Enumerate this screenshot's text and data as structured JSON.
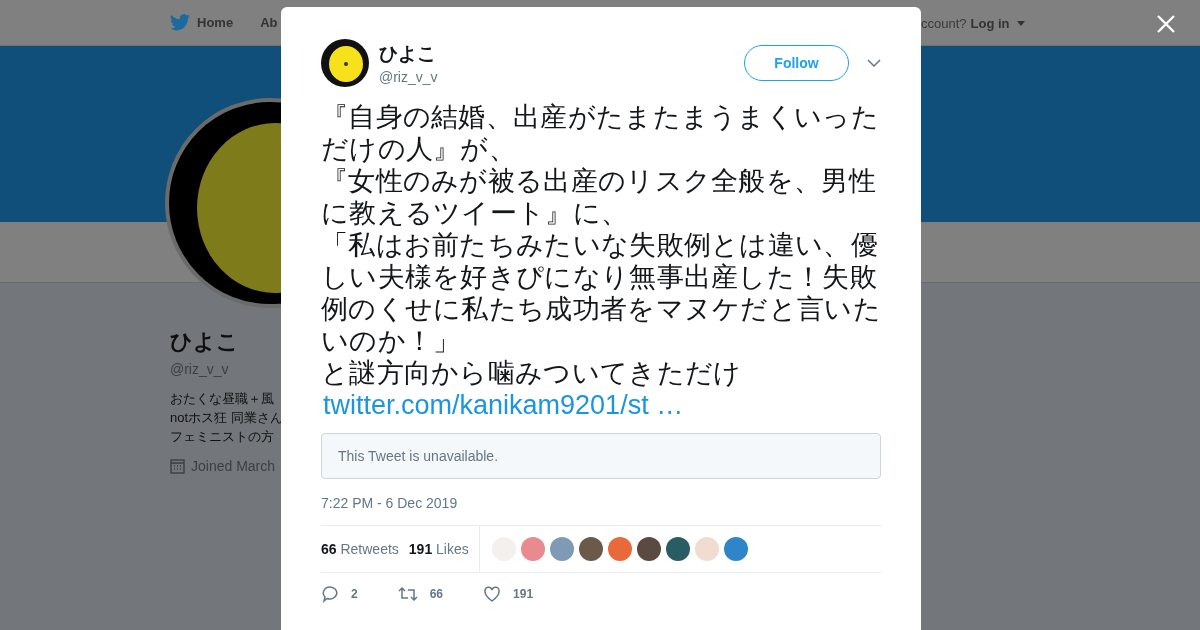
{
  "nav": {
    "home": "Home",
    "about": "Ab",
    "account_prompt": "ccount?",
    "login": "Log in"
  },
  "profile": {
    "name": "ひよこ",
    "handle": "@riz_v_v",
    "bio_lines": [
      "おたくな昼職＋風",
      "notホス狂 同業さん",
      "フェミニストの方"
    ],
    "joined": "Joined March"
  },
  "tweet": {
    "name": "ひよこ",
    "handle": "@riz_v_v",
    "follow": "Follow",
    "paragraphs": [
      "『自身の結婚、出産がたまたまうまくいっただけの人』が、",
      "『女性のみが被る出産のリスク全般を、男性に教えるツイート』に、",
      "「私はお前たちみたいな失敗例とは違い、優しい夫様を好きぴになり無事出産した！失敗例のくせに私たち成功者をマヌケだと言いたいのか！」",
      "と謎方向から噛みついてきただけ"
    ],
    "link": "twitter.com/kanikam9201/st …",
    "quoted": "This Tweet is unavailable.",
    "time": "7:22 PM - 6 Dec 2019",
    "retweets": {
      "count": "66",
      "label": "Retweets"
    },
    "likes": {
      "count": "191",
      "label": "Likes"
    },
    "liker_avatars": [
      {
        "color": "#f4f0ee"
      },
      {
        "color": "#e88a8f"
      },
      {
        "color": "#7f9ab5"
      },
      {
        "color": "#6b5a4a"
      },
      {
        "color": "#e86a3a"
      },
      {
        "color": "#5b4a42"
      },
      {
        "color": "#2a5d63"
      },
      {
        "color": "#f0dcd0"
      },
      {
        "color": "#2e86c8"
      }
    ],
    "actions": [
      {
        "kind": "reply",
        "count": "2"
      },
      {
        "kind": "retweet",
        "count": "66"
      },
      {
        "kind": "like",
        "count": "191"
      }
    ]
  }
}
